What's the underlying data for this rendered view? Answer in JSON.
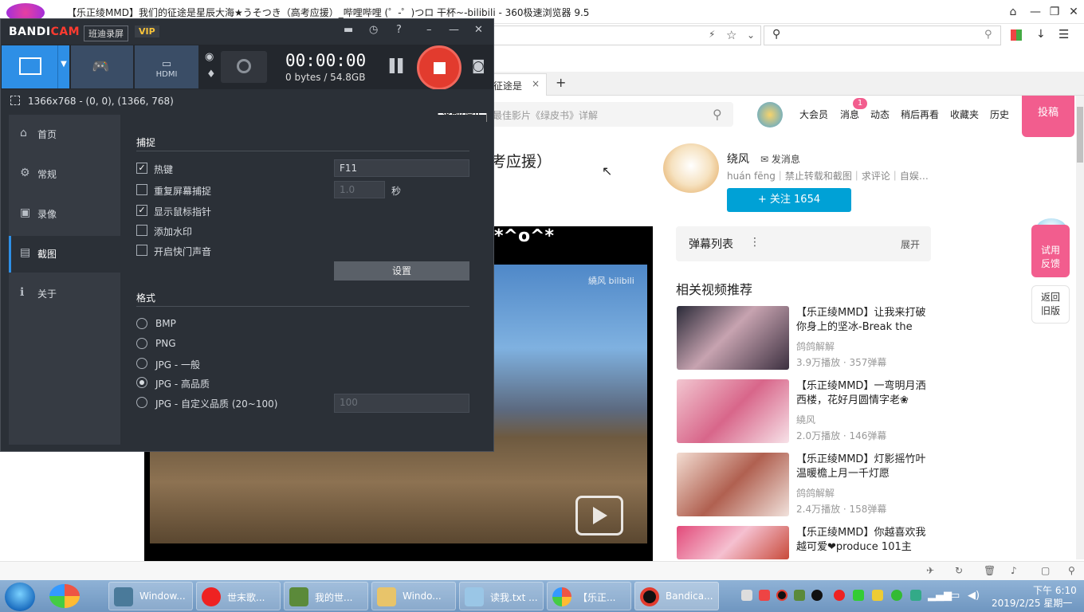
{
  "browser": {
    "title": "【乐正绫MMD】我们的征途是星辰大海★うそつき（高考应援）_哔哩哔哩 (゜-゜)つロ 干杯~-bilibili - 360极速浏览器 9.5",
    "address_partial": "/",
    "tab_label": "征途是",
    "tab_close": "×",
    "tab_add": "+"
  },
  "site": {
    "search_placeholder": "最佳影片《绿皮书》详解",
    "nav": [
      "大会员",
      "消息",
      "动态",
      "稍后再看",
      "收藏夹",
      "历史"
    ],
    "msg_count": "1",
    "upload_label": "投稿",
    "video_title_partial": "考应援）",
    "up_name": "绕风",
    "send_msg": "发消息",
    "up_sign": "huán fēng｜禁止转载和截图｜求评论｜自娱…",
    "follow_label": "+  关注 1654",
    "player_overlay": "*^o^*",
    "player_watermark": "繞风 bilibili",
    "danmu_title": "弹幕列表",
    "danmu_expand": "展开",
    "related_title": "相关视频推荐",
    "related": [
      {
        "title": "【乐正绫MMD】让我来打破你身上的坚冰-Break the",
        "up": "鸽鸽解解",
        "stat": "3.9万播放 · 357弹幕"
      },
      {
        "title": "【乐正绫MMD】一弯明月洒西楼，花好月圆情字老❀",
        "up": "繞风",
        "stat": "2.0万播放 · 146弹幕"
      },
      {
        "title": "【乐正绫MMD】灯影摇竹叶 温暖檐上月一千灯愿",
        "up": "鸽鸽解解",
        "stat": "2.4万播放 · 158弹幕"
      },
      {
        "title": "【乐正绫MMD】你越喜欢我越可爱❤produce 101主",
        "up": "",
        "stat": ""
      }
    ],
    "side_float1": "试用\n反馈",
    "side_float2": "返回\n旧版"
  },
  "bandicam": {
    "logo_a": "BANDI",
    "logo_b": "CAM",
    "cn_label": "班迪录屏",
    "vip": "VIP",
    "timer": "00:00:00",
    "size": "0 bytes / 54.8GB",
    "tooltip": "录制/停止",
    "hdmi": "HDMI",
    "info": "1366x768 - (0, 0), (1366, 768)",
    "sidebar": [
      "首页",
      "常规",
      "录像",
      "截图",
      "关于"
    ],
    "capture_section": "捕捉",
    "capture_opts": [
      {
        "label": "热键",
        "checked": true
      },
      {
        "label": "重复屏幕捕捉",
        "checked": false
      },
      {
        "label": "显示鼠标指针",
        "checked": true
      },
      {
        "label": "添加水印",
        "checked": false
      },
      {
        "label": "开启快门声音",
        "checked": false
      }
    ],
    "hotkey_value": "F11",
    "repeat_value": "1.0",
    "seconds_label": "秒",
    "settings_btn": "设置",
    "format_section": "格式",
    "formats": [
      "BMP",
      "PNG",
      "JPG - 一般",
      "JPG - 高品质",
      "JPG - 自定义品质 (20~100)"
    ],
    "selected_format": 3,
    "quality_value": "100"
  },
  "taskbar": {
    "items": [
      "Window...",
      "世末歌...",
      "我的世...",
      "Windo...",
      "读我.txt ...",
      "【乐正...",
      "Bandica..."
    ],
    "time": "下午 6:10",
    "date": "2019/2/25 星期一"
  },
  "colors": {
    "bili_pink": "#f25d8e",
    "bili_blue": "#00a1d6",
    "bc_blue": "#2e8fe6",
    "rec_red": "#e23b2e"
  }
}
